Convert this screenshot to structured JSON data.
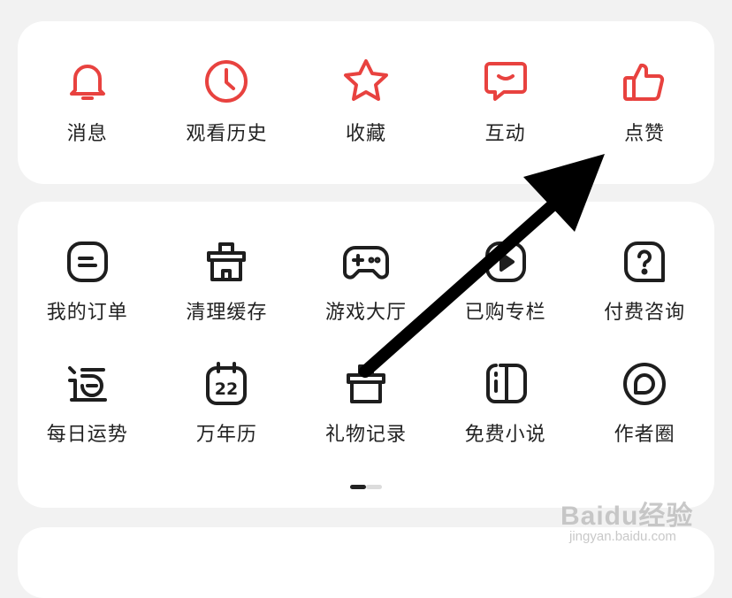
{
  "colors": {
    "accent": "#e8423f",
    "ink": "#1e1e1e",
    "card": "#ffffff",
    "background": "#f2f2f2"
  },
  "top_actions": [
    {
      "label": "消息",
      "icon": "bell-icon"
    },
    {
      "label": "观看历史",
      "icon": "clock-icon"
    },
    {
      "label": "收藏",
      "icon": "star-icon"
    },
    {
      "label": "互动",
      "icon": "chat-bubble-icon"
    },
    {
      "label": "点赞",
      "icon": "thumbs-up-icon"
    }
  ],
  "tools": {
    "row1": [
      {
        "label": "我的订单",
        "icon": "order-icon"
      },
      {
        "label": "清理缓存",
        "icon": "clean-cache-icon"
      },
      {
        "label": "游戏大厅",
        "icon": "gamepad-icon"
      },
      {
        "label": "已购专栏",
        "icon": "play-column-icon"
      },
      {
        "label": "付费咨询",
        "icon": "paid-consult-icon"
      }
    ],
    "row2": [
      {
        "label": "每日运势",
        "icon": "fortune-icon"
      },
      {
        "label": "万年历",
        "icon": "calendar-icon",
        "calendar_day": "22"
      },
      {
        "label": "礼物记录",
        "icon": "gift-icon"
      },
      {
        "label": "免费小说",
        "icon": "book-icon"
      },
      {
        "label": "作者圈",
        "icon": "author-circle-icon"
      }
    ]
  },
  "pager": {
    "current_page": 1,
    "total_pages": 2
  },
  "watermark": {
    "brand": "Baidu经验",
    "url": "jingyan.baidu.com"
  }
}
